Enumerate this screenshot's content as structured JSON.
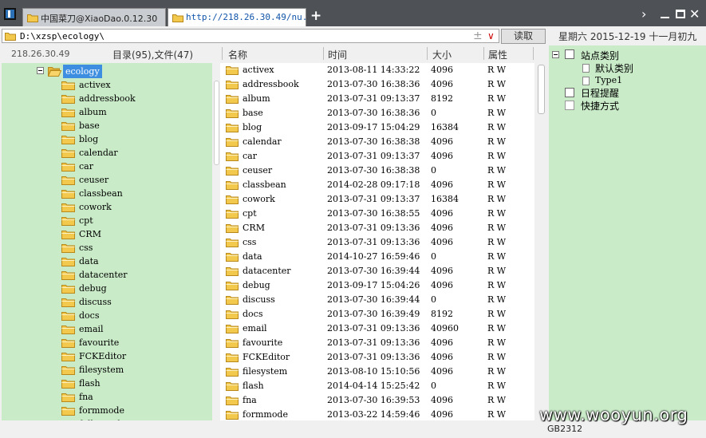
{
  "tabs": [
    {
      "label": "中国菜刀@XiaoDao.0.12.30"
    },
    {
      "label": "http://218.26.30.49/nu..."
    }
  ],
  "new_tab_label": "+",
  "address": {
    "path": "D:\\xzsp\\ecology\\",
    "plus": "±",
    "read_button": "读取"
  },
  "date_text": "星期六 2015-12-19 十一月初九",
  "server_ip": "218.26.30.49",
  "dir_summary": "目录(95),文件(47)",
  "columns": {
    "name": "名称",
    "time": "时间",
    "size": "大小",
    "attr": "属性"
  },
  "tree": {
    "root": "ecology",
    "children": [
      "activex",
      "addressbook",
      "album",
      "base",
      "blog",
      "calendar",
      "car",
      "ceuser",
      "classbean",
      "cowork",
      "cpt",
      "CRM",
      "css",
      "data",
      "datacenter",
      "debug",
      "discuss",
      "docs",
      "email",
      "favourite",
      "FCKEditor",
      "filesystem",
      "flash",
      "fna",
      "formmode",
      "fullsearch"
    ]
  },
  "files": [
    {
      "name": "activex",
      "time": "2013-08-11 14:33:22",
      "size": "4096",
      "attr": "R W"
    },
    {
      "name": "addressbook",
      "time": "2013-07-30 16:38:36",
      "size": "4096",
      "attr": "R W"
    },
    {
      "name": "album",
      "time": "2013-07-31 09:13:37",
      "size": "8192",
      "attr": "R W"
    },
    {
      "name": "base",
      "time": "2013-07-30 16:38:36",
      "size": "0",
      "attr": "R W"
    },
    {
      "name": "blog",
      "time": "2013-09-17 15:04:29",
      "size": "16384",
      "attr": "R W"
    },
    {
      "name": "calendar",
      "time": "2013-07-30 16:38:38",
      "size": "4096",
      "attr": "R W"
    },
    {
      "name": "car",
      "time": "2013-07-31 09:13:37",
      "size": "4096",
      "attr": "R W"
    },
    {
      "name": "ceuser",
      "time": "2013-07-30 16:38:38",
      "size": "0",
      "attr": "R W"
    },
    {
      "name": "classbean",
      "time": "2014-02-28 09:17:18",
      "size": "4096",
      "attr": "R W"
    },
    {
      "name": "cowork",
      "time": "2013-07-31 09:13:37",
      "size": "16384",
      "attr": "R W"
    },
    {
      "name": "cpt",
      "time": "2013-07-30 16:38:55",
      "size": "4096",
      "attr": "R W"
    },
    {
      "name": "CRM",
      "time": "2013-07-31 09:13:36",
      "size": "4096",
      "attr": "R W"
    },
    {
      "name": "css",
      "time": "2013-07-31 09:13:36",
      "size": "4096",
      "attr": "R W"
    },
    {
      "name": "data",
      "time": "2014-10-27 16:59:46",
      "size": "0",
      "attr": "R W"
    },
    {
      "name": "datacenter",
      "time": "2013-07-30 16:39:44",
      "size": "4096",
      "attr": "R W"
    },
    {
      "name": "debug",
      "time": "2013-09-17 15:04:26",
      "size": "4096",
      "attr": "R W"
    },
    {
      "name": "discuss",
      "time": "2013-07-30 16:39:44",
      "size": "0",
      "attr": "R W"
    },
    {
      "name": "docs",
      "time": "2013-07-30 16:39:49",
      "size": "8192",
      "attr": "R W"
    },
    {
      "name": "email",
      "time": "2013-07-31 09:13:36",
      "size": "40960",
      "attr": "R W"
    },
    {
      "name": "favourite",
      "time": "2013-07-31 09:13:36",
      "size": "4096",
      "attr": "R W"
    },
    {
      "name": "FCKEditor",
      "time": "2013-07-31 09:13:36",
      "size": "4096",
      "attr": "R W"
    },
    {
      "name": "filesystem",
      "time": "2013-08-10 15:10:56",
      "size": "4096",
      "attr": "R W"
    },
    {
      "name": "flash",
      "time": "2014-04-14 15:25:42",
      "size": "0",
      "attr": "R W"
    },
    {
      "name": "fna",
      "time": "2013-07-30 16:39:53",
      "size": "4096",
      "attr": "R W"
    },
    {
      "name": "formmode",
      "time": "2013-03-22 14:59:46",
      "size": "4096",
      "attr": "R W"
    }
  ],
  "site_panel": {
    "root": "站点类别",
    "children": [
      "默认类别",
      "Type1"
    ],
    "schedule": "日程提醒",
    "shortcuts": "快捷方式"
  },
  "status": {
    "encoding": "GB2312"
  },
  "watermark": "www.wooyun.org",
  "colors": {
    "tree_bg": "#c9ebc8",
    "selection": "#3d8ee0",
    "folder": "#f2c94c",
    "titlebar": "#4e5257"
  }
}
